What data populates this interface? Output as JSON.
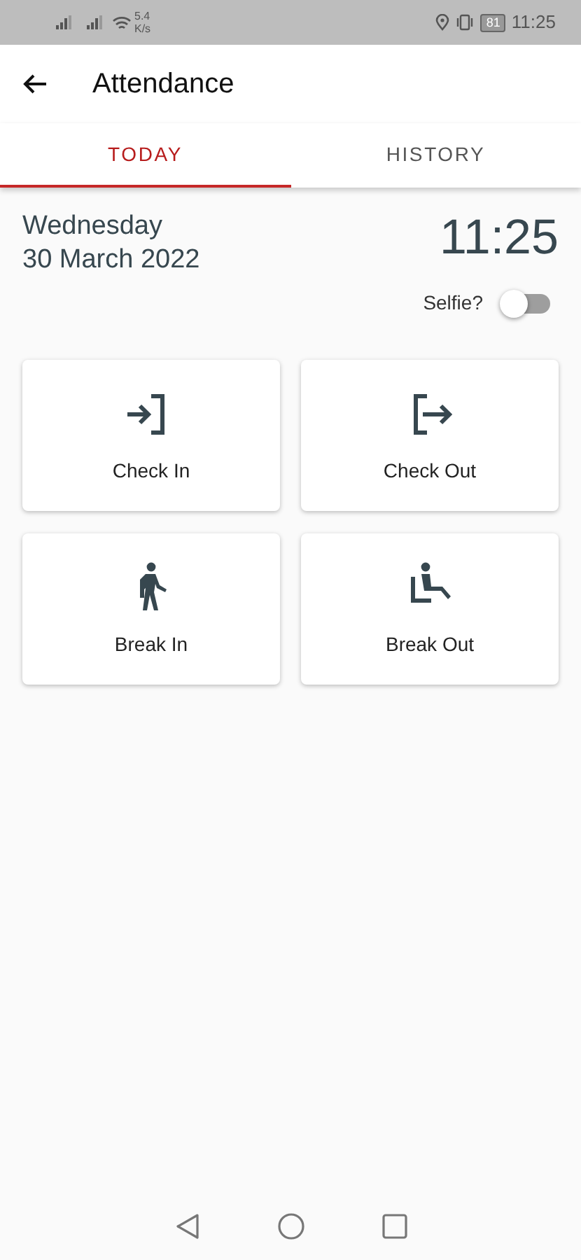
{
  "status_bar": {
    "speed_value": "5.4",
    "speed_unit": "K/s",
    "battery": "81",
    "time": "11:25"
  },
  "app_bar": {
    "title": "Attendance"
  },
  "tabs": [
    {
      "label": "TODAY",
      "selected": true
    },
    {
      "label": "HISTORY",
      "selected": false
    }
  ],
  "date": {
    "weekday": "Wednesday",
    "full_date": "30 March 2022"
  },
  "clock": "11:25",
  "selfie": {
    "label": "Selfie?",
    "on": false
  },
  "actions": [
    {
      "kind": "check-in",
      "label": "Check In"
    },
    {
      "kind": "check-out",
      "label": "Check Out"
    },
    {
      "kind": "break-in",
      "label": "Break In"
    },
    {
      "kind": "break-out",
      "label": "Break Out"
    }
  ]
}
